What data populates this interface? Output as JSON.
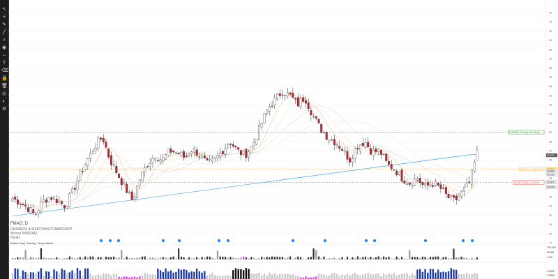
{
  "toolbar": {
    "tools": [
      "cursor-icon",
      "crosshair-icon",
      "pencil-icon",
      "trendline-icon",
      "zoom-icon",
      "magnet-icon",
      "measure-icon",
      "text-icon",
      "eraser-icon",
      "lock-icon",
      "trash-icon",
      "eye-icon",
      "palette-icon",
      "settings-icon"
    ]
  },
  "symbol": {
    "ticker": "FMAO, D",
    "name": "FARMERS & MERCHANTS BANCORP",
    "exchange": "Across NASDAQ",
    "sector": "Banks"
  },
  "volume_pane_label": "Profiled Vwap Tracking - Tempo Based",
  "colors": {
    "up": "#ffffff",
    "down": "#c0272d",
    "wick": "#333333",
    "target": "#2e7d32",
    "entry": "#f5a623",
    "stop": "#e53935",
    "ma200": "#42a5f5",
    "ema": "#f0c890",
    "sma": "#d0d0d0",
    "pane_blue": "#1e3caa",
    "pane_grey": "#c8c8c8",
    "pane_pink": "#e040fb",
    "accent_cyan": "#0d82ff"
  },
  "chart_data": {
    "type": "candlestick",
    "price_axis": {
      "min": 17,
      "max": 44,
      "ticks": [
        "42",
        "41",
        "40",
        "39",
        "38",
        "37",
        "36",
        "35",
        "34",
        "33",
        "32",
        "31",
        "30",
        "29",
        "28",
        "27",
        "26",
        "25",
        "24",
        "23",
        "22",
        "21",
        "20",
        "19",
        "18",
        "17"
      ]
    },
    "levels": [
      {
        "label": "TARGET 29.00 (+16.05%)",
        "value": 29.0,
        "kind": "target"
      },
      {
        "label": "ENTRY LOW 25.00",
        "value": 25.0,
        "kind": "entry"
      },
      {
        "label": "STOP 23.53 (-5.92%)",
        "value": 23.53,
        "kind": "stop"
      }
    ],
    "axis_badges": [
      {
        "label": "26.500",
        "value": 26.5
      },
      {
        "label": "24.99",
        "value": 24.99
      },
      {
        "label": "24.600",
        "value": 24.8
      },
      {
        "label": "24.131",
        "value": 24.4
      },
      {
        "label": "23.670",
        "value": 23.6
      },
      {
        "label": "23.093",
        "value": 23.05
      }
    ],
    "anchors": [
      21.8,
      21.4,
      20.8,
      20.0,
      21.5,
      22.0,
      21.6,
      21.0,
      22.5,
      24.5,
      26.0,
      27.5,
      28.5,
      26.0,
      24.5,
      23.0,
      21.6,
      24.0,
      25.5,
      26.5,
      26.0,
      27.0,
      26.8,
      26.2,
      27.2,
      26.5,
      25.5,
      26.0,
      27.0,
      28.0,
      27.0,
      26.5,
      27.5,
      29.5,
      31.5,
      32.5,
      33.5,
      33.0,
      32.0,
      32.8,
      31.0,
      29.5,
      28.5,
      28.0,
      27.2,
      26.0,
      27.5,
      28.0,
      26.8,
      27.0,
      25.5,
      25.0,
      24.0,
      23.5,
      24.0,
      23.0,
      23.5,
      23.0,
      22.0,
      21.5,
      22.5,
      23.5,
      26.8
    ],
    "ema_note": "",
    "volume_pane": {
      "ticks": [
        "200.000",
        "50.8M",
        "0.3M"
      ]
    },
    "oscillator_pane": {
      "ticks": [
        "0.4000",
        "0.3560"
      ]
    }
  }
}
